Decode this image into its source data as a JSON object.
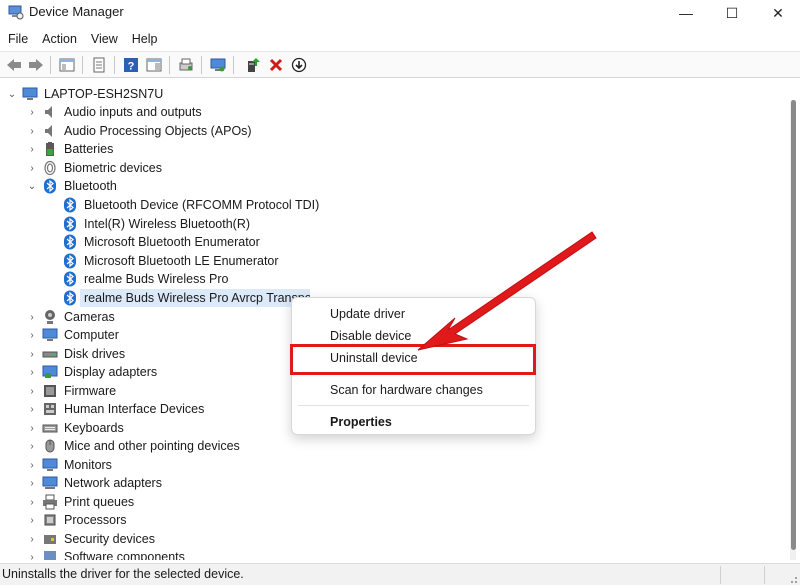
{
  "window": {
    "title": "Device Manager",
    "minimize_glyph": "—",
    "maximize_glyph": "☐",
    "close_glyph": "✕"
  },
  "menu": [
    "File",
    "Action",
    "View",
    "Help"
  ],
  "toolbar": {
    "buttons": [
      "back-icon",
      "forward-icon",
      "show-hide-console-tree-icon",
      "properties-icon",
      "help-icon",
      "action-pane-icon",
      "scan-hardware-icon",
      "monitor-icon",
      "update-driver-icon",
      "uninstall-icon",
      "disable-device-icon"
    ]
  },
  "tree": {
    "root": "LAPTOP-ESH2SN7U",
    "categories": [
      {
        "label": "Audio inputs and outputs",
        "icon": "speaker-icon"
      },
      {
        "label": "Audio Processing Objects (APOs)",
        "icon": "speaker-icon"
      },
      {
        "label": "Batteries",
        "icon": "battery-icon"
      },
      {
        "label": "Biometric devices",
        "icon": "fingerprint-icon"
      },
      {
        "label": "Bluetooth",
        "icon": "bluetooth-icon",
        "expanded": true
      },
      {
        "label": "Cameras",
        "icon": "camera-icon"
      },
      {
        "label": "Computer",
        "icon": "computer-icon"
      },
      {
        "label": "Disk drives",
        "icon": "disk-drive-icon"
      },
      {
        "label": "Display adapters",
        "icon": "display-adapter-icon"
      },
      {
        "label": "Firmware",
        "icon": "firmware-icon"
      },
      {
        "label": "Human Interface Devices",
        "icon": "hid-icon"
      },
      {
        "label": "Keyboards",
        "icon": "keyboard-icon"
      },
      {
        "label": "Mice and other pointing devices",
        "icon": "mouse-icon"
      },
      {
        "label": "Monitors",
        "icon": "monitor-icon"
      },
      {
        "label": "Network adapters",
        "icon": "network-adapter-icon"
      },
      {
        "label": "Print queues",
        "icon": "printer-icon"
      },
      {
        "label": "Processors",
        "icon": "processor-icon"
      },
      {
        "label": "Security devices",
        "icon": "security-icon"
      },
      {
        "label": "Software components",
        "icon": "software-icon"
      }
    ],
    "bluetooth_children": [
      "Bluetooth Device (RFCOMM Protocol TDI)",
      "Intel(R) Wireless Bluetooth(R)",
      "Microsoft Bluetooth Enumerator",
      "Microsoft Bluetooth LE Enumerator",
      "realme Buds Wireless Pro",
      "realme Buds Wireless Pro Avrcp Transport"
    ]
  },
  "context_menu": {
    "update_driver": "Update driver",
    "disable_device": "Disable device",
    "uninstall_device": "Uninstall device",
    "scan_hardware": "Scan for hardware changes",
    "properties": "Properties"
  },
  "status": {
    "text": "Uninstalls the driver for the selected device."
  },
  "colors": {
    "accent_red": "#e0191b",
    "bluetooth_blue": "#1f6fd1",
    "selection": "#dbe9f8"
  }
}
